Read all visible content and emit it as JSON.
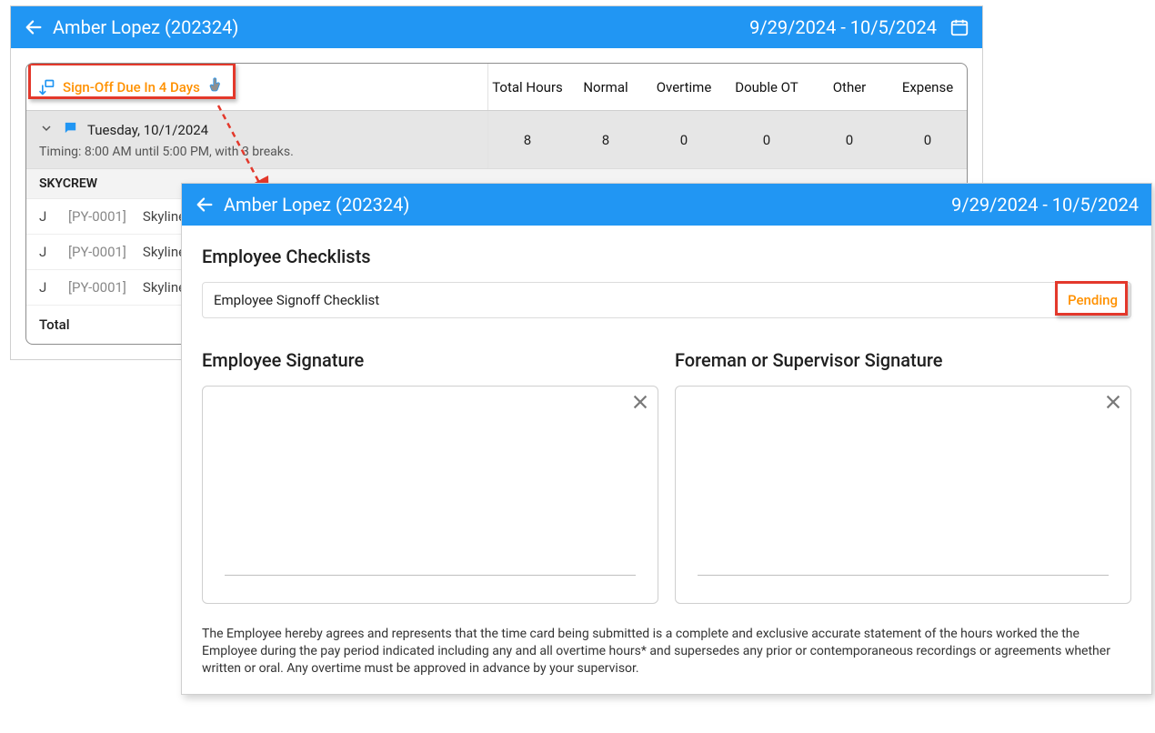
{
  "header": {
    "employee": "Amber Lopez (202324)",
    "date_range": "9/29/2024 - 10/5/2024"
  },
  "signoff_notice": "Sign-Off Due In 4 Days",
  "columns": {
    "total_hours": "Total Hours",
    "normal": "Normal",
    "overtime": "Overtime",
    "double_ot": "Double OT",
    "other": "Other",
    "expense": "Expense"
  },
  "day": {
    "label": "Tuesday, 10/1/2024",
    "timing": "Timing: 8:00 AM until 5:00 PM, with 3 breaks.",
    "total": "8",
    "normal": "8",
    "overtime": "0",
    "double_ot": "0",
    "other": "0",
    "expense": "0"
  },
  "crew": "SKYCREW",
  "jobs": [
    {
      "j": "J",
      "pid": "[PY-0001]",
      "name": "Skyline To"
    },
    {
      "j": "J",
      "pid": "[PY-0001]",
      "name": "Skyline To"
    },
    {
      "j": "J",
      "pid": "[PY-0001]",
      "name": "Skyline To"
    }
  ],
  "total_label": "Total",
  "front": {
    "section_title": "Employee Checklists",
    "checklist_name": "Employee Signoff Checklist",
    "checklist_status": "Pending",
    "sig_employee": "Employee Signature",
    "sig_supervisor": "Foreman or Supervisor Signature",
    "disclaimer": "The Employee hereby agrees and represents that the time card being submitted is a complete and exclusive accurate statement of the hours worked the the Employee during the pay period indicated including any and all overtime hours* and supersedes any prior or contemporaneous recordings or agreements whether written or oral. Any overtime must be approved in advance by your supervisor."
  }
}
